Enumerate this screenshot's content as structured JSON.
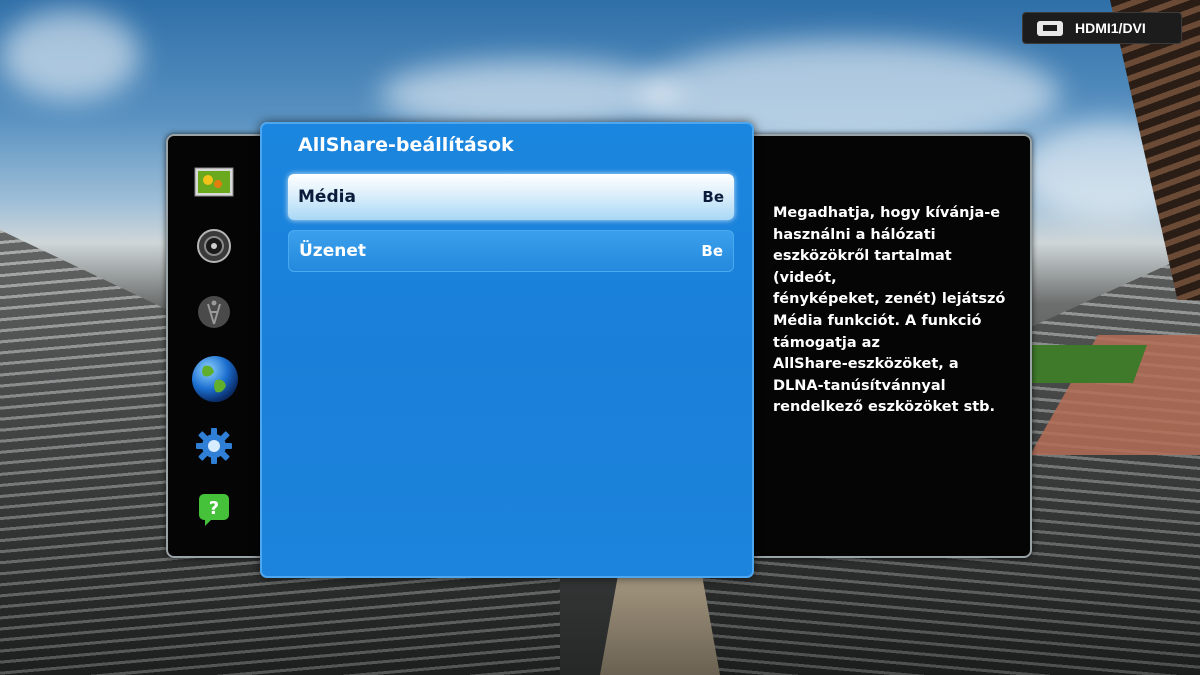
{
  "source": {
    "label": "HDMI1/DVI",
    "icon": "hdmi-icon"
  },
  "sidebar": {
    "items": [
      {
        "icon": "picture-icon"
      },
      {
        "icon": "sound-icon"
      },
      {
        "icon": "broadcast-icon"
      },
      {
        "icon": "network-globe-icon",
        "selected": true
      },
      {
        "icon": "system-gear-icon"
      },
      {
        "icon": "support-question-icon"
      }
    ]
  },
  "menu": {
    "title": "AllShare-beállítások",
    "items": [
      {
        "label": "Média",
        "value": "Be",
        "selected": true
      },
      {
        "label": "Üzenet",
        "value": "Be",
        "selected": false
      }
    ]
  },
  "help": {
    "lines": [
      "Megadhatja, hogy kívánja-e",
      "használni a hálózati",
      "eszközökről tartalmat (videót,",
      "fényképeket, zenét) lejátszó",
      "Média funkciót. A funkció",
      "támogatja az",
      "AllShare-eszközöket, a",
      "DLNA-tanúsítvánnyal",
      "rendelkező eszközöket stb."
    ]
  },
  "colors": {
    "menu_blue": "#1a7fd8",
    "selected_item": "#dceffb",
    "panel_black": "#050505"
  }
}
